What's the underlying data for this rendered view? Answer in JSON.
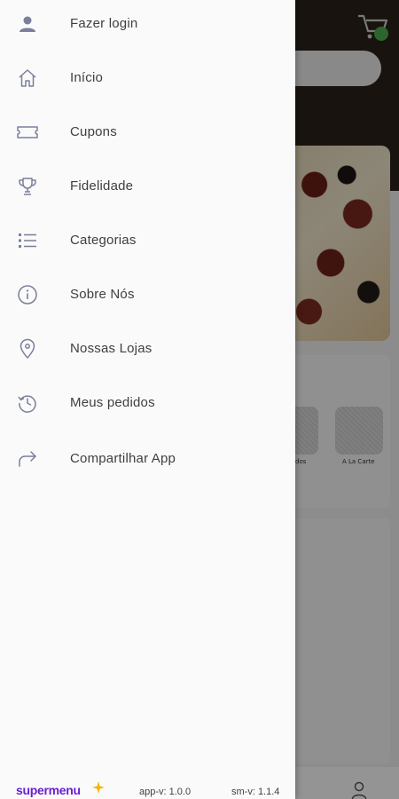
{
  "menu": {
    "items": [
      {
        "label": "Fazer login",
        "icon": "user-icon"
      },
      {
        "label": "Início",
        "icon": "home-icon"
      },
      {
        "label": "Cupons",
        "icon": "ticket-icon"
      },
      {
        "label": "Fidelidade",
        "icon": "trophy-icon"
      },
      {
        "label": "Categorias",
        "icon": "list-icon"
      },
      {
        "label": "Sobre Nós",
        "icon": "info-icon"
      },
      {
        "label": "Nossas Lojas",
        "icon": "location-pin-icon"
      },
      {
        "label": "Meus pedidos",
        "icon": "history-icon"
      },
      {
        "label": "Compartilhar App",
        "icon": "share-icon"
      }
    ]
  },
  "footer": {
    "brand": "supermenu",
    "app_version": "app-v: 1.0.0",
    "sm_version": "sm-v: 1.1.4"
  },
  "background": {
    "category_labels": [
      "dos",
      "A La Carte"
    ]
  },
  "colors": {
    "brand": "#6a1fd0",
    "brand_spark": "#f4b400",
    "cart_badge": "#4caf50",
    "header_bg": "#2a2119",
    "icon": "#7a7f9a"
  }
}
